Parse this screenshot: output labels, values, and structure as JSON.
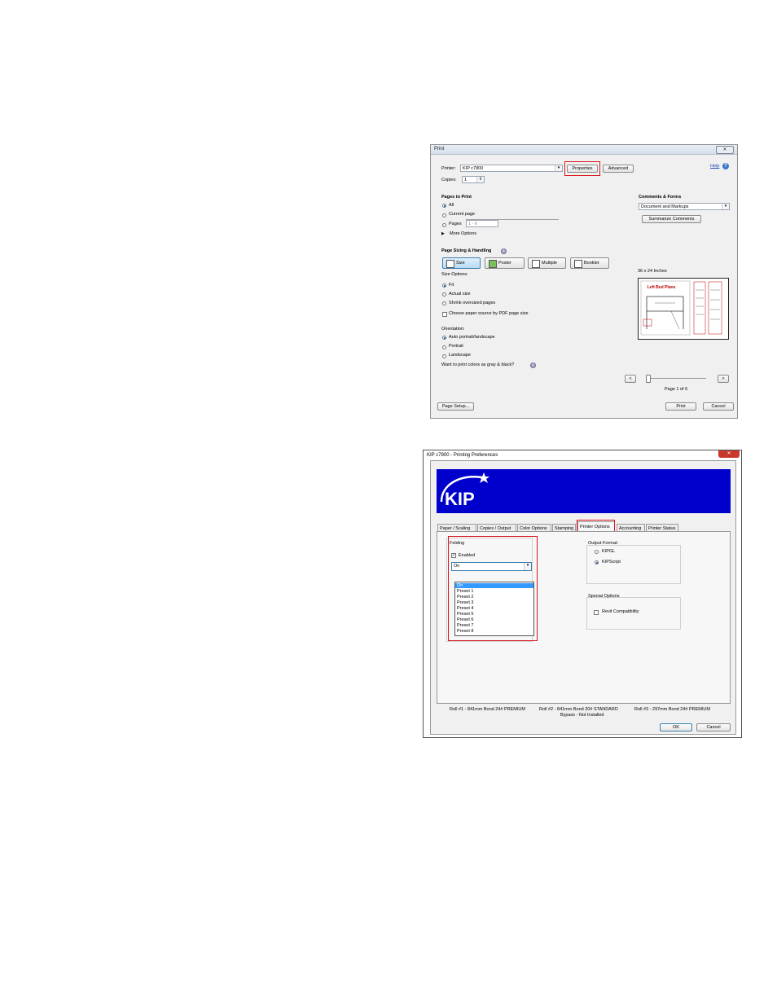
{
  "print_dialog": {
    "title": "Print",
    "close": "✕",
    "printer_label": "Printer:",
    "printer_value": "KIP c7800",
    "properties_button": "Properties",
    "advanced_button": "Advanced",
    "help_link": "Help",
    "copies_label": "Copies:",
    "copies_value": "1",
    "pages_to_print": {
      "heading": "Pages to Print",
      "all": "All",
      "current_page": "Current page",
      "pages": "Pages",
      "pages_range": "1 - 6",
      "more_options": "More Options"
    },
    "comments_forms": {
      "heading": "Comments & Forms",
      "value": "Document and Markups",
      "summarize_button": "Summarize Comments"
    },
    "sizing": {
      "heading": "Page Sizing & Handling",
      "size_button": "Size",
      "poster_button": "Poster",
      "multiple_button": "Multiple",
      "booklet_button": "Booklet",
      "size_options_label": "Size Options:",
      "fit": "Fit",
      "actual_size": "Actual size",
      "shrink": "Shrink oversized pages",
      "choose_source": "Choose paper source by PDF page size"
    },
    "orientation": {
      "label": "Orientation:",
      "auto": "Auto portrait/landscape",
      "portrait": "Portrait",
      "landscape": "Landscape",
      "gray_question": "Want to print colors as gray & black?"
    },
    "preview": {
      "size_label": "36 x 24 Inches",
      "doc_title": "Left Bed Plans",
      "page_label": "Page 1 of 6",
      "prev": "<",
      "next": ">"
    },
    "page_setup_button": "Page Setup...",
    "print_button": "Print",
    "cancel_button": "Cancel"
  },
  "prefs_dialog": {
    "title": "KIP c7800 - Printing Preferences",
    "close": "✕",
    "logo_text": "KIP",
    "tabs": [
      "Paper / Scaling",
      "Copies / Output",
      "Color Options",
      "Stamping",
      "Printer Options",
      "Accounting",
      "Printer Status"
    ],
    "folding": {
      "label": "Folding",
      "enabled_label": "Enabled",
      "selected": "On",
      "options": [
        "On",
        "Preset 1",
        "Preset 2",
        "Preset 3",
        "Preset 4",
        "Preset 5",
        "Preset 6",
        "Preset 7",
        "Preset 8"
      ]
    },
    "output_format": {
      "label": "Output Format:",
      "kipgl": "KIPGL",
      "kipscript": "KIPScript"
    },
    "special_options": {
      "label": "Special Options",
      "revit": "Revit Compatibility"
    },
    "status": {
      "roll1": "Roll #1 - 841mm Bond 24# PREMIUM",
      "roll2": "Roll #2 - 841mm Bond 20# STANDARD",
      "roll3": "Roll #3 - 297mm Bond 24# PREMIUM",
      "bypass": "Bypass - Not Installed"
    },
    "ok_button": "OK",
    "cancel_button": "Cancel"
  },
  "colors": {
    "highlight_red": "#d9141b",
    "banner_blue": "#0000cc"
  }
}
